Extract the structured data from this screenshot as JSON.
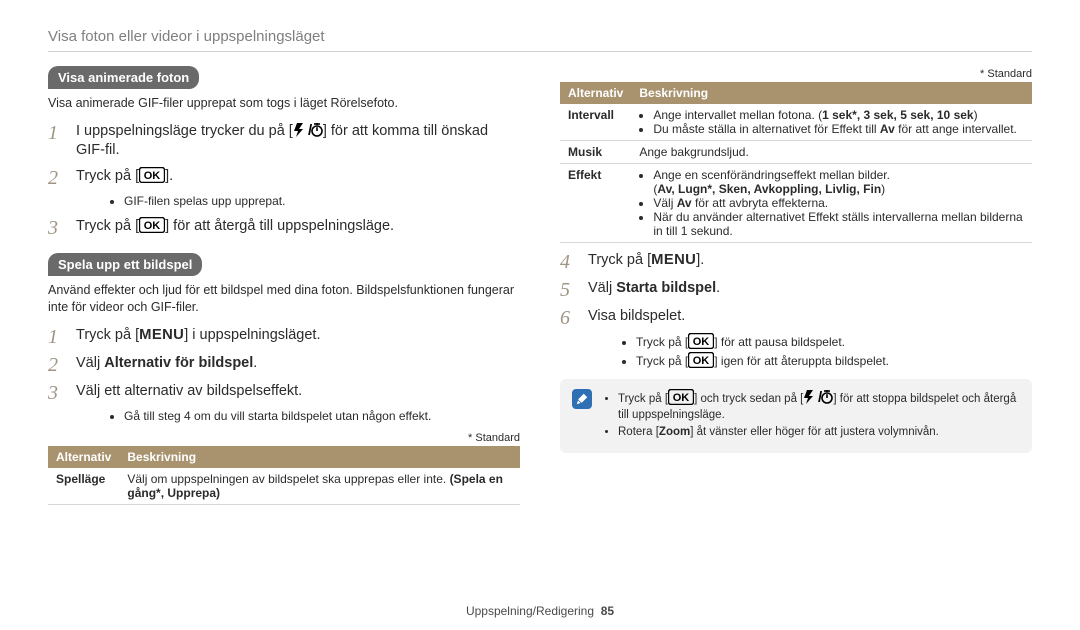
{
  "header": "Visa foton eller videor i uppspelningsläget",
  "footer": {
    "section": "Uppspelning/Redigering",
    "page": "85"
  },
  "left": {
    "pill_anim": "Visa animerade foton",
    "anim_intro": "Visa animerade GIF-filer upprepat som togs i läget Rörelsefoto.",
    "step1_a": "I uppspelningsläge trycker du på [",
    "step1_b": "] för att komma till önskad GIF-fil.",
    "step2_a": "Tryck på [",
    "step2_b": "].",
    "step2_sub": "GIF-filen spelas upp upprepat.",
    "step3_a": "Tryck på [",
    "step3_b": "] för att återgå till uppspelningsläge.",
    "pill_slide": "Spela upp ett bildspel",
    "slide_intro": "Använd effekter och ljud för ett bildspel med dina foton. Bildspelsfunktionen fungerar inte för videor och GIF-filer.",
    "s1_a": "Tryck på [",
    "s1_b": "] i uppspelningsläget.",
    "s2": "Välj ",
    "s2_b": "Alternativ för bildspel",
    "s2_c": ".",
    "s3": "Välj ett alternativ av bildspelseffekt.",
    "s3_sub": "Gå till steg 4 om du vill starta bildspelet utan någon effekt.",
    "std": "* Standard",
    "th_a": "Alternativ",
    "th_b": "Beskrivning",
    "row1_a": "Spelläge",
    "row1_b": "Välj om uppspelningen av bildspelet ska upprepas eller inte. ",
    "row1_c": "(Spela en gång*, Upprepa)"
  },
  "right": {
    "std": "* Standard",
    "th_a": "Alternativ",
    "th_b": "Beskrivning",
    "r1_a": "Intervall",
    "r1_b1": "Ange intervallet mellan fotona. (",
    "r1_b1b": "1 sek*, 3 sek, 5 sek, 10 sek",
    "r1_b1c": ")",
    "r1_b2a": "Du måste ställa in alternativet för Effekt till ",
    "r1_b2b": "Av",
    "r1_b2c": " för att ange intervallet.",
    "r2_a": "Musik",
    "r2_b": "Ange bakgrundsljud.",
    "r3_a": "Effekt",
    "r3_b1": "Ange en scenförändringseffekt mellan bilder.",
    "r3_b1b": "Av, Lugn*, Sken, Avkoppling, Livlig, Fin",
    "r3_b2a": "Välj ",
    "r3_b2b": "Av",
    "r3_b2c": " för att avbryta effekterna.",
    "r3_b3": "När du använder alternativet Effekt ställs intervallerna mellan bilderna in till 1 sekund.",
    "s4_a": "Tryck på [",
    "s4_b": "].",
    "s5": "Välj ",
    "s5_b": "Starta bildspel",
    "s5_c": ".",
    "s6": "Visa bildspelet.",
    "sub1_a": "Tryck på [",
    "sub1_b": "] för att pausa bildspelet.",
    "sub2_a": "Tryck på [",
    "sub2_b": "] igen för att återuppta bildspelet.",
    "note1_a": "Tryck på [",
    "note1_b": "] och tryck sedan på [",
    "note1_c": "] för att stoppa bildspelet och återgå till uppspelningsläge.",
    "note2_a": "Rotera [",
    "note2_b": "Zoom",
    "note2_c": "] åt vänster eller höger för att justera volymnivån."
  }
}
